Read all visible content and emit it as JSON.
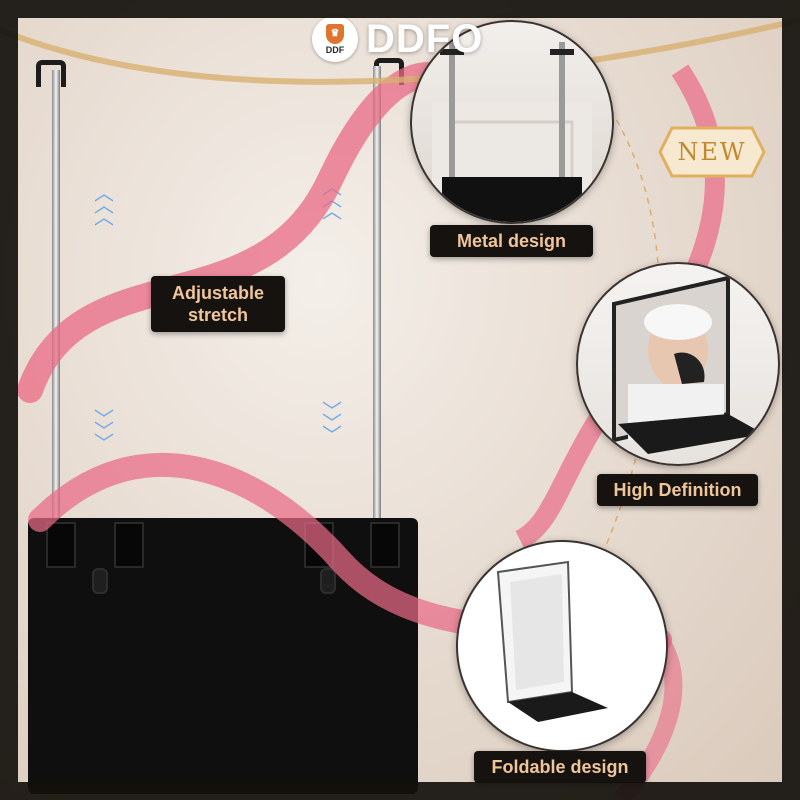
{
  "brand": {
    "badge_abbr": "DDF",
    "name": "DDFO",
    "accent": "#e0742c"
  },
  "badge": {
    "text": "NEW",
    "color": "#c2882f"
  },
  "features": {
    "metal": "Metal design",
    "stretch_line1": "Adjustable",
    "stretch_line2": "stretch",
    "high_def": "High Definition",
    "foldable": "Foldable design"
  },
  "colors": {
    "label_bg": "#15120f",
    "label_text": "#f0c59a",
    "ribbon": "#e96a86",
    "arrow": "#6ea9e6"
  }
}
